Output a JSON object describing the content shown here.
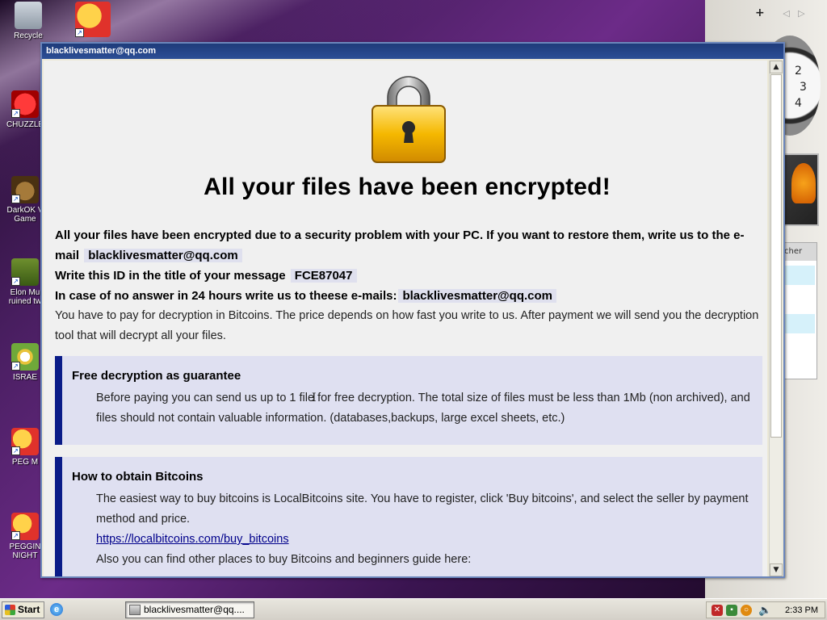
{
  "window": {
    "title": "blacklivesmatter@qq.com"
  },
  "content": {
    "headline": "All your files have been encrypted!",
    "intro_line1": "All your files have been encrypted due to a security problem with your PC. If you want to restore them, write us to the e-mail",
    "contact_email": "blacklivesmatter@qq.com",
    "id_prompt": "Write this ID in the title of your message",
    "victim_id": "FCE87047",
    "no_answer_prompt": "In case of no answer in 24 hours write us to theese e-mails:",
    "backup_email": "blacklivesmatter@qq.com",
    "payment_text": "You have to pay for decryption in Bitcoins. The price depends on how fast you write to us. After payment we will send you the decryption tool that will decrypt all your files."
  },
  "panels": {
    "free": {
      "title": "Free decryption as guarantee",
      "body": "Before paying you can send us up to 1 file for free decryption. The total size of files must be less than 1Mb (non archived), and files should not contain valuable information. (databases,backups, large excel sheets, etc.)"
    },
    "btc": {
      "title": "How to obtain Bitcoins",
      "body": "The easiest way to buy bitcoins is LocalBitcoins site. You have to register, click 'Buy bitcoins', and select the seller by payment method and price.",
      "link": "https://localbitcoins.com/buy_bitcoins",
      "more": "Also you can find other places to buy Bitcoins and beginners guide here:"
    }
  },
  "desktop": {
    "icons": [
      {
        "label": "Recycle",
        "icon": "recycle-bin-icon"
      },
      {
        "label": "",
        "icon": "peggle-icon"
      },
      {
        "label": "CHUZZLE",
        "icon": "chuzzle-icon"
      },
      {
        "label": "DarkOK V Game",
        "icon": "game-icon"
      },
      {
        "label": "Elon Mu ruined tw",
        "icon": "game-icon"
      },
      {
        "label": "ISRAE",
        "icon": "game-icon"
      },
      {
        "label": "PEG M",
        "icon": "peggle-icon"
      },
      {
        "label": "PEGGIN NIGHT",
        "icon": "peggle-icon"
      }
    ]
  },
  "sidebar": {
    "add_label": "+",
    "clock_numbers": [
      "2",
      "3",
      "4"
    ],
    "launcher_tab": "cher"
  },
  "taskbar": {
    "start_label": "Start",
    "task_item": "blacklivesmatter@qq....",
    "clock": "2:33 PM"
  },
  "scroll": {
    "up": "▲",
    "down": "▼"
  }
}
